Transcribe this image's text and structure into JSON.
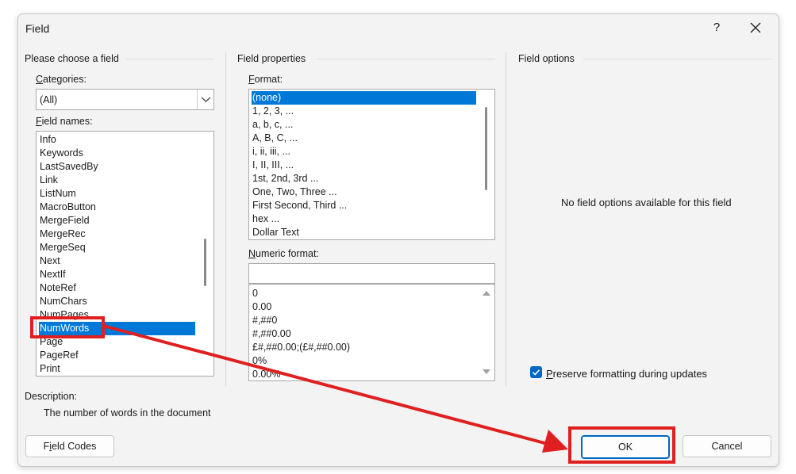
{
  "dialog": {
    "title": "Field",
    "help_label": "?",
    "close_icon": "close-icon"
  },
  "left": {
    "section_title": "Please choose a field",
    "categories_label": "Categories:",
    "categories_value": "(All)",
    "field_names_label": "Field names:",
    "field_names": [
      "Info",
      "Keywords",
      "LastSavedBy",
      "Link",
      "ListNum",
      "MacroButton",
      "MergeField",
      "MergeRec",
      "MergeSeq",
      "Next",
      "NextIf",
      "NoteRef",
      "NumChars",
      "NumPages",
      "NumWords",
      "Page",
      "PageRef",
      "Print"
    ],
    "selected_field": "NumWords"
  },
  "middle": {
    "section_title": "Field properties",
    "format_label": "Format:",
    "formats": [
      "(none)",
      "1, 2, 3, ...",
      "a, b, c, ...",
      "A, B, C, ...",
      "i, ii, iii, ...",
      "I, II, III, ...",
      "1st, 2nd, 3rd ...",
      "One, Two, Three ...",
      "First Second, Third ...",
      "hex ...",
      "Dollar Text"
    ],
    "selected_format": "(none)",
    "numeric_label": "Numeric format:",
    "numeric_value": "",
    "numeric_formats": [
      "0",
      "0.00",
      "#,##0",
      "#,##0.00",
      "£#,##0.00;(£#,##0.00)",
      "0%",
      "0.00%"
    ]
  },
  "right": {
    "section_title": "Field options",
    "no_options_text": "No field options available for this field",
    "preserve_label": "Preserve formatting during updates",
    "preserve_checked": true
  },
  "description": {
    "label": "Description:",
    "text": "The number of words in the document"
  },
  "buttons": {
    "field_codes": "Field Codes",
    "ok": "OK",
    "cancel": "Cancel"
  },
  "colors": {
    "selection": "#0078d7",
    "annotation": "#e02020",
    "accent": "#0067c0"
  }
}
